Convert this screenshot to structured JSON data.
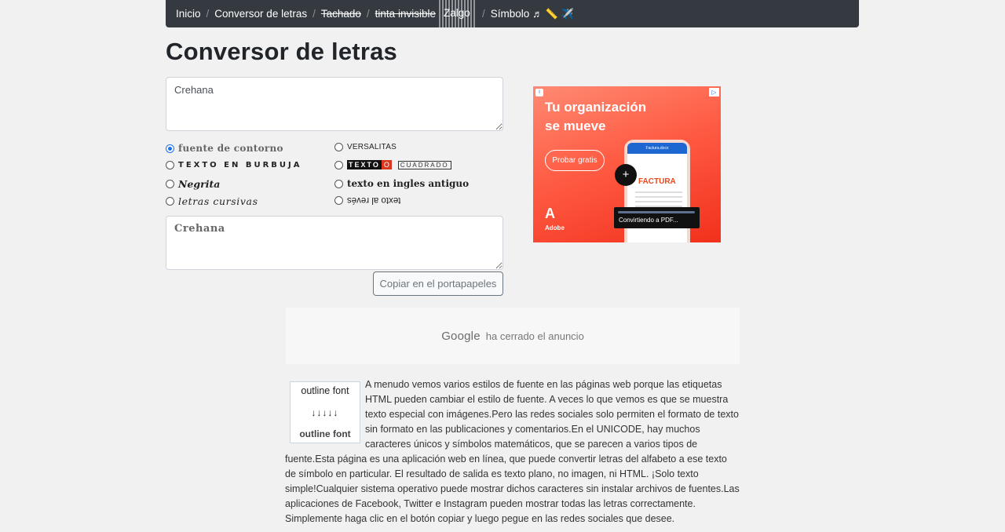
{
  "breadcrumb": {
    "items": [
      "Inicio",
      "Conversor de letras",
      "Tachado",
      "tinta invisible",
      "Zalgo",
      "Símbolo"
    ],
    "separator": "/",
    "symbol_icons": "♬ 📏 ✈️"
  },
  "page": {
    "title": "Conversor de letras"
  },
  "converter": {
    "input_value": "Crehana",
    "output_value": "Crehana",
    "copy_label": "Copiar en el portapapeles",
    "selected_option": "fuente de contorno",
    "options_left": [
      "fuente de contorno",
      "TEXTO EN BURBUJA",
      "Negrita",
      "letras cursivas"
    ],
    "options_right": [
      "VERSALITAS",
      "TEXTO",
      "CUADRADO",
      "texto en ingles antiguo",
      "texto al revés"
    ]
  },
  "ad": {
    "title_line1": "Tu organización",
    "title_line2": "se mueve",
    "cta": "Probar gratis",
    "app_header": "Factura.docx",
    "doc_title": "FACTURA",
    "toast": "Convirtiendo a PDF...",
    "brand": "Adobe",
    "brand_mark": "A"
  },
  "closed_ad": {
    "brand": "Google",
    "message": "ha cerrado el anuncio"
  },
  "thumbnail": {
    "top": "outline font",
    "arrows": "↓↓↓↓↓",
    "bottom": "outline font"
  },
  "article": {
    "text": "A menudo vemos varios estilos de fuente en las páginas web porque las etiquetas HTML pueden cambiar el estilo de fuente. A veces lo que vemos es que se muestra texto especial con imágenes.Pero las redes sociales solo permiten el formato de texto sin formato en las publicaciones y comentarios.En el UNICODE, hay muchos caracteres únicos y símbolos matemáticos, que se parecen a varios tipos de fuente.Esta página es una aplicación web en línea, que puede convertir letras del alfabeto a ese texto de símbolo en particular. El resultado de salida es texto plano, no imagen, ni HTML. ¡Solo texto simple!Cualquier sistema operativo puede mostrar dichos caracteres sin instalar archivos de fuentes.Las aplicaciones de Facebook, Twitter e Instagram pueden mostrar todas las letras correctamente. Simplemente haga clic en el botón copiar y luego pegue en las redes sociales que desee."
  }
}
